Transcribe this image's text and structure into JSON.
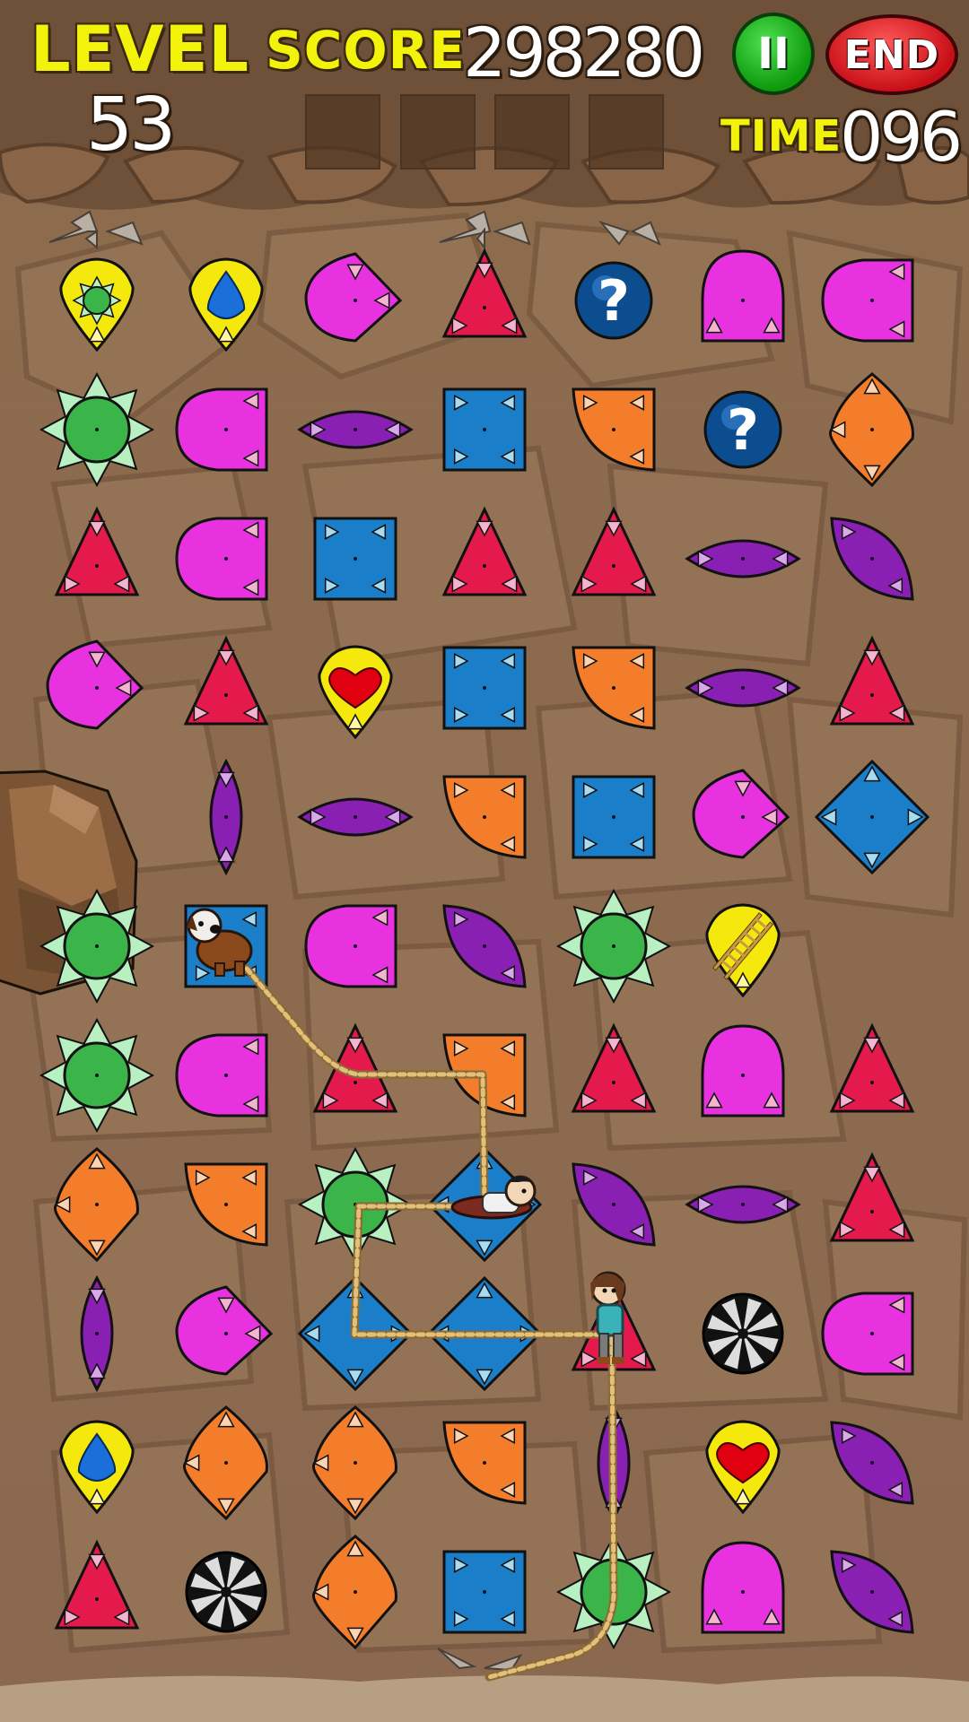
{
  "hud": {
    "level_label": "LEVEL",
    "level_value": "53",
    "score_label": "SCORE",
    "score_value": "298280",
    "time_label": "TIME",
    "time_value": "096",
    "pause_label": "II",
    "end_label": "END"
  },
  "colors": {
    "yellow": "#f5e80c",
    "green": "#3bb54a",
    "magenta": "#e832e0",
    "purple": "#8a1fb3",
    "red": "#e51a4c",
    "blue": "#1a7ec9",
    "orange": "#f37d2a",
    "help": "#0c4d8f",
    "rope": "#d9b26b"
  },
  "tiles": [
    [
      "yellow-drop-sun",
      "yellow-drop-water",
      "magenta-drop",
      "red-triangle",
      "help-bubble",
      "magenta-arch",
      "magenta-half"
    ],
    [
      "green-star",
      "magenta-half",
      "purple-leaf-h",
      "blue-square",
      "orange-quarter",
      "help-bubble",
      "orange-kite"
    ],
    [
      "red-triangle",
      "magenta-half",
      "blue-square",
      "red-triangle",
      "red-triangle",
      "purple-leaf-h",
      "purple-leaf-d"
    ],
    [
      "magenta-drop",
      "red-triangle",
      "yellow-drop-heart",
      "blue-square",
      "orange-quarter",
      "purple-leaf-h",
      "red-triangle"
    ],
    [
      null,
      "purple-leaf-v",
      "purple-leaf-h",
      "orange-quarter",
      "blue-square",
      "magenta-drop",
      "blue-diamond"
    ],
    [
      "green-star",
      "blue-square",
      "magenta-half",
      "purple-leaf-d",
      "green-star",
      "yellow-drop-ladder",
      null
    ],
    [
      "green-star",
      "magenta-half",
      "red-triangle",
      "orange-quarter",
      "red-triangle",
      "magenta-arch",
      "red-triangle"
    ],
    [
      "orange-kite",
      "orange-quarter",
      "green-star",
      "blue-diamond",
      "purple-leaf-d",
      "purple-leaf-h",
      "red-triangle"
    ],
    [
      "purple-leaf-v",
      "magenta-drop",
      "blue-diamond",
      "blue-diamond",
      "red-triangle",
      "black-wheel",
      "magenta-half"
    ],
    [
      "yellow-drop-water",
      "orange-kite",
      "orange-kite",
      "orange-quarter",
      "purple-leaf-v",
      "yellow-drop-heart",
      "purple-leaf-d"
    ],
    [
      "red-triangle",
      "black-wheel",
      "orange-kite",
      "blue-square",
      "green-star",
      "magenta-arch",
      "purple-leaf-d"
    ]
  ],
  "characters": [
    "dog",
    "boy",
    "girl"
  ],
  "icons": [
    "boulder-icon",
    "help-icon",
    "heart-icon",
    "water-drop-icon",
    "ladder-icon",
    "wheel-icon",
    "arrow-icon"
  ]
}
